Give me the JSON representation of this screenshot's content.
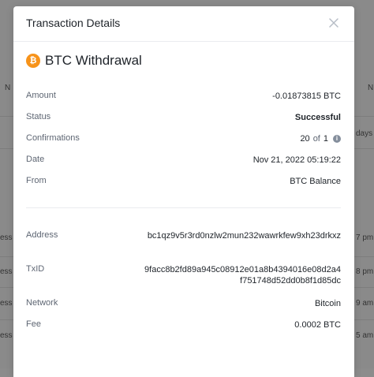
{
  "background": {
    "partial_texts": [
      {
        "text": "N",
        "side": "left",
        "row": 0
      },
      {
        "text": "N",
        "side": "right",
        "row": 0
      },
      {
        "text": "days",
        "side": "right",
        "row": 1
      },
      {
        "text": "ess",
        "side": "left",
        "row": 2
      },
      {
        "text": "7 pm",
        "side": "right",
        "row": 2
      },
      {
        "text": "ess",
        "side": "left",
        "row": 3
      },
      {
        "text": "8 pm",
        "side": "right",
        "row": 3
      },
      {
        "text": "ess",
        "side": "left",
        "row": 4
      },
      {
        "text": "9 am",
        "side": "right",
        "row": 4
      },
      {
        "text": "ess",
        "side": "left",
        "row": 5
      },
      {
        "text": "5 am",
        "side": "right",
        "row": 5
      }
    ]
  },
  "modal": {
    "title": "Transaction Details",
    "close_icon": "close-icon",
    "transaction_title": "BTC Withdrawal",
    "coin_icon": "bitcoin-icon",
    "coin_symbol": "₿",
    "accent_color": "#f7931a",
    "details": {
      "amount_label": "Amount",
      "amount_value": "-0.01873815 BTC",
      "status_label": "Status",
      "status_value": "Successful",
      "confirmations_label": "Confirmations",
      "confirmations_current": "20",
      "confirmations_of": "of",
      "confirmations_required": "1",
      "date_label": "Date",
      "date_value": "Nov 21, 2022 05:19:22",
      "from_label": "From",
      "from_value": "BTC Balance",
      "address_label": "Address",
      "address_value": "bc1qz9v5r3rd0nzlw2mun232wawrkfew9xh23drkxz",
      "txid_label": "TxID",
      "txid_value": "9facc8b2fd89a945c08912e01a8b4394016e08d2a4f751748d52dd0b8f1d85dc",
      "network_label": "Network",
      "network_value": "Bitcoin",
      "fee_label": "Fee",
      "fee_value": "0.0002 BTC"
    }
  }
}
